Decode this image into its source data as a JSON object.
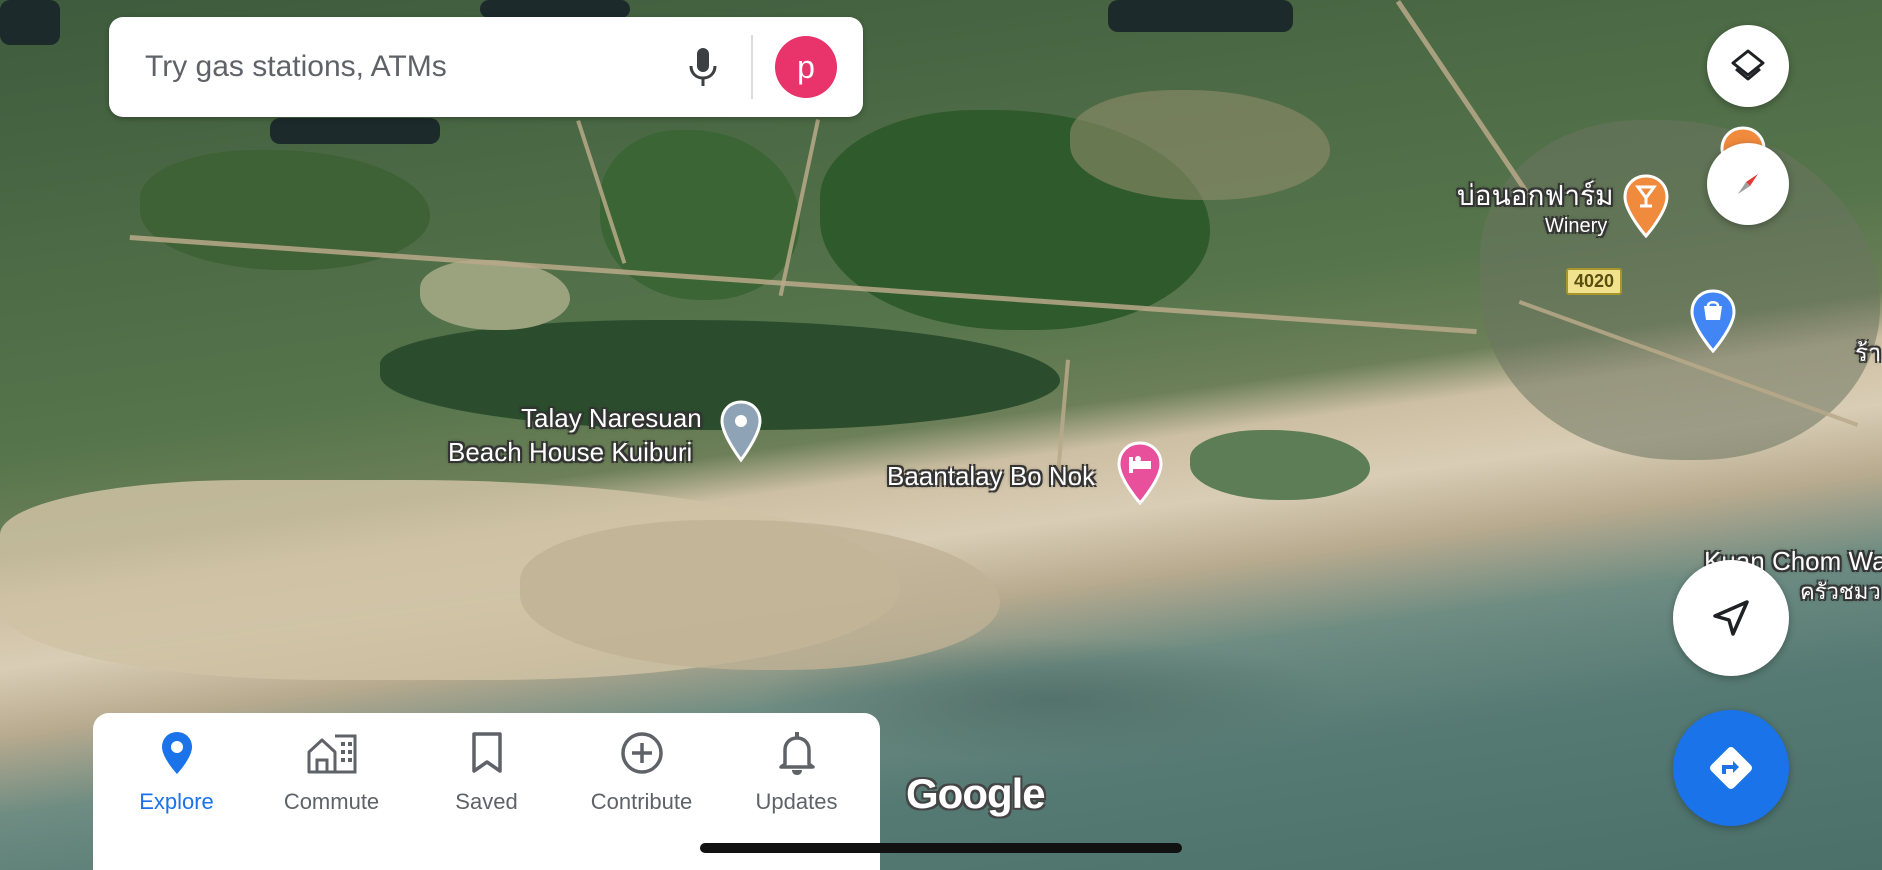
{
  "search": {
    "placeholder": "Try gas stations, ATMs",
    "avatar_letter": "p"
  },
  "map": {
    "labels": {
      "talay_line1": "Talay Naresuan",
      "talay_line2": "Beach House Kuiburi",
      "baantalay": "Baantalay Bo Nok",
      "winery_thai": "บ่อนอกฟาร์ม",
      "winery": "Winery",
      "road_number": "4020",
      "kuan_chom": "Kuan Chom Wa",
      "kuan_chom_thai": "ครัวชมว",
      "edge_thai": "ร้า"
    },
    "attribution": "Google"
  },
  "bottom_nav": {
    "items": [
      {
        "label": "Explore",
        "icon": "explore-pin-icon",
        "active": true
      },
      {
        "label": "Commute",
        "icon": "commute-icon",
        "active": false
      },
      {
        "label": "Saved",
        "icon": "bookmark-icon",
        "active": false
      },
      {
        "label": "Contribute",
        "icon": "add-circle-icon",
        "active": false
      },
      {
        "label": "Updates",
        "icon": "bell-icon",
        "active": false
      }
    ]
  },
  "colors": {
    "accent": "#1a73e8",
    "avatar": "#e8336b",
    "hotel_pin": "#e8509c",
    "winery_pin": "#f08a3c",
    "shop_pin": "#4285f4"
  }
}
